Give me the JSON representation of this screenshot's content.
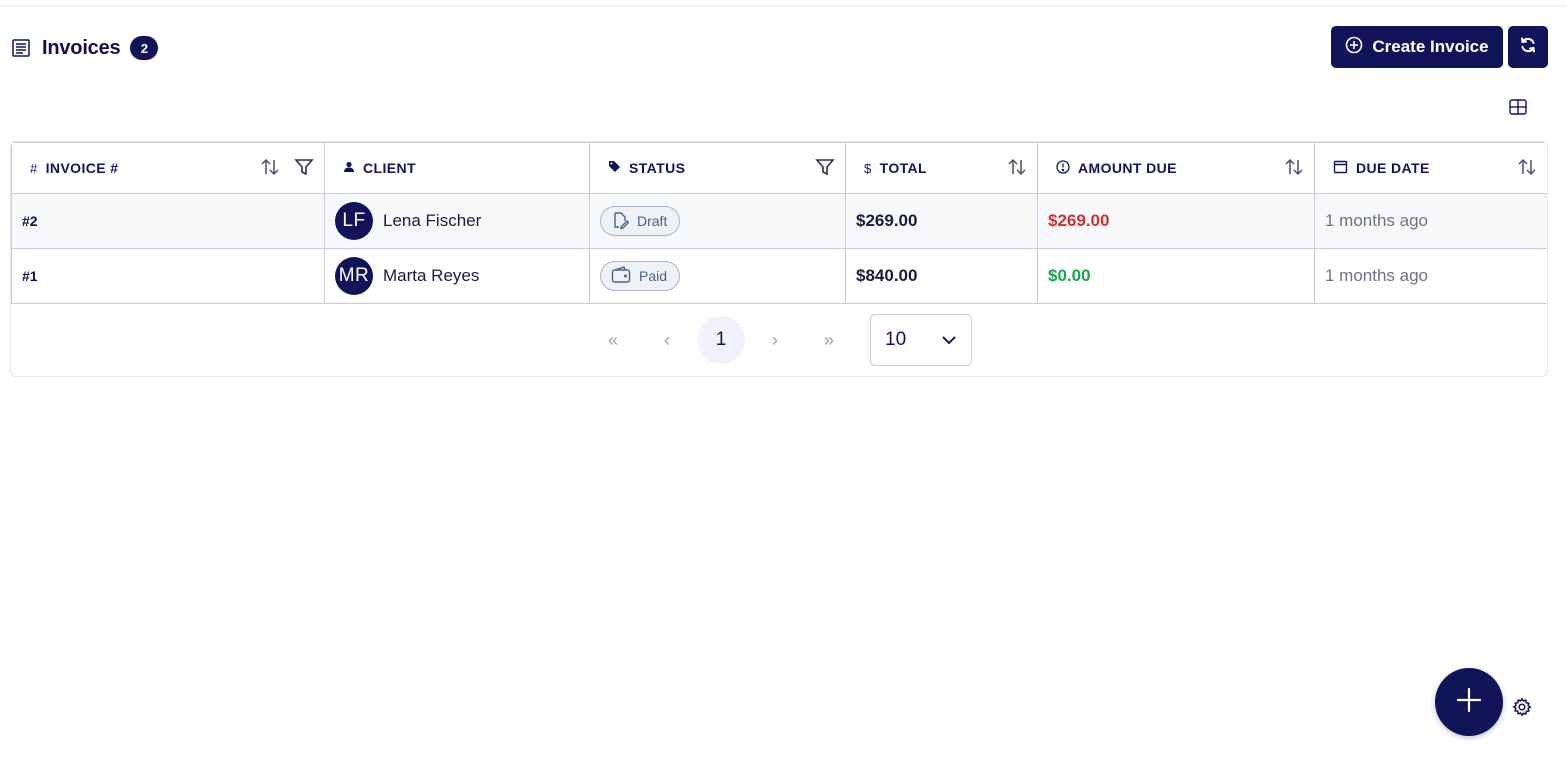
{
  "header": {
    "title": "Invoices",
    "count": "2",
    "icon": "invoice-list-icon"
  },
  "actions": {
    "create_label": "Create Invoice",
    "create_icon": "plus-circle-icon",
    "refresh_icon": "refresh-icon",
    "columns_icon": "columns-grid-icon"
  },
  "table": {
    "columns": [
      {
        "label": "INVOICE #",
        "icon": "hash-icon",
        "sortable": true,
        "filterable": true
      },
      {
        "label": "CLIENT",
        "icon": "user-icon",
        "sortable": false,
        "filterable": false
      },
      {
        "label": "STATUS",
        "icon": "tag-icon",
        "sortable": false,
        "filterable": true
      },
      {
        "label": "TOTAL",
        "icon": "dollar-icon",
        "sortable": true,
        "filterable": false
      },
      {
        "label": "AMOUNT DUE",
        "icon": "alert-circle-icon",
        "sortable": true,
        "filterable": false
      },
      {
        "label": "DUE DATE",
        "icon": "calendar-icon",
        "sortable": true,
        "filterable": false
      }
    ],
    "rows": [
      {
        "invoice": "#2",
        "client_initials": "LF",
        "client_name": "Lena Fischer",
        "status": "Draft",
        "status_icon": "edit-document-icon",
        "total": "$269.00",
        "amount_due": "$269.00",
        "due_color": "#d22f2f",
        "due_date": "1 months ago"
      },
      {
        "invoice": "#1",
        "client_initials": "MR",
        "client_name": "Marta Reyes",
        "status": "Paid",
        "status_icon": "wallet-icon",
        "total": "$840.00",
        "amount_due": "$0.00",
        "due_color": "#1aa34a",
        "due_date": "1 months ago"
      }
    ]
  },
  "pagination": {
    "first": "«",
    "prev": "‹",
    "current_page": "1",
    "next": "›",
    "last": "»",
    "page_size": "10"
  },
  "fab": {
    "icon": "plus-icon"
  },
  "settings": {
    "icon": "gear-icon"
  },
  "colors": {
    "primary": "#12145a",
    "danger": "#d22f2f",
    "success": "#1aa34a"
  }
}
